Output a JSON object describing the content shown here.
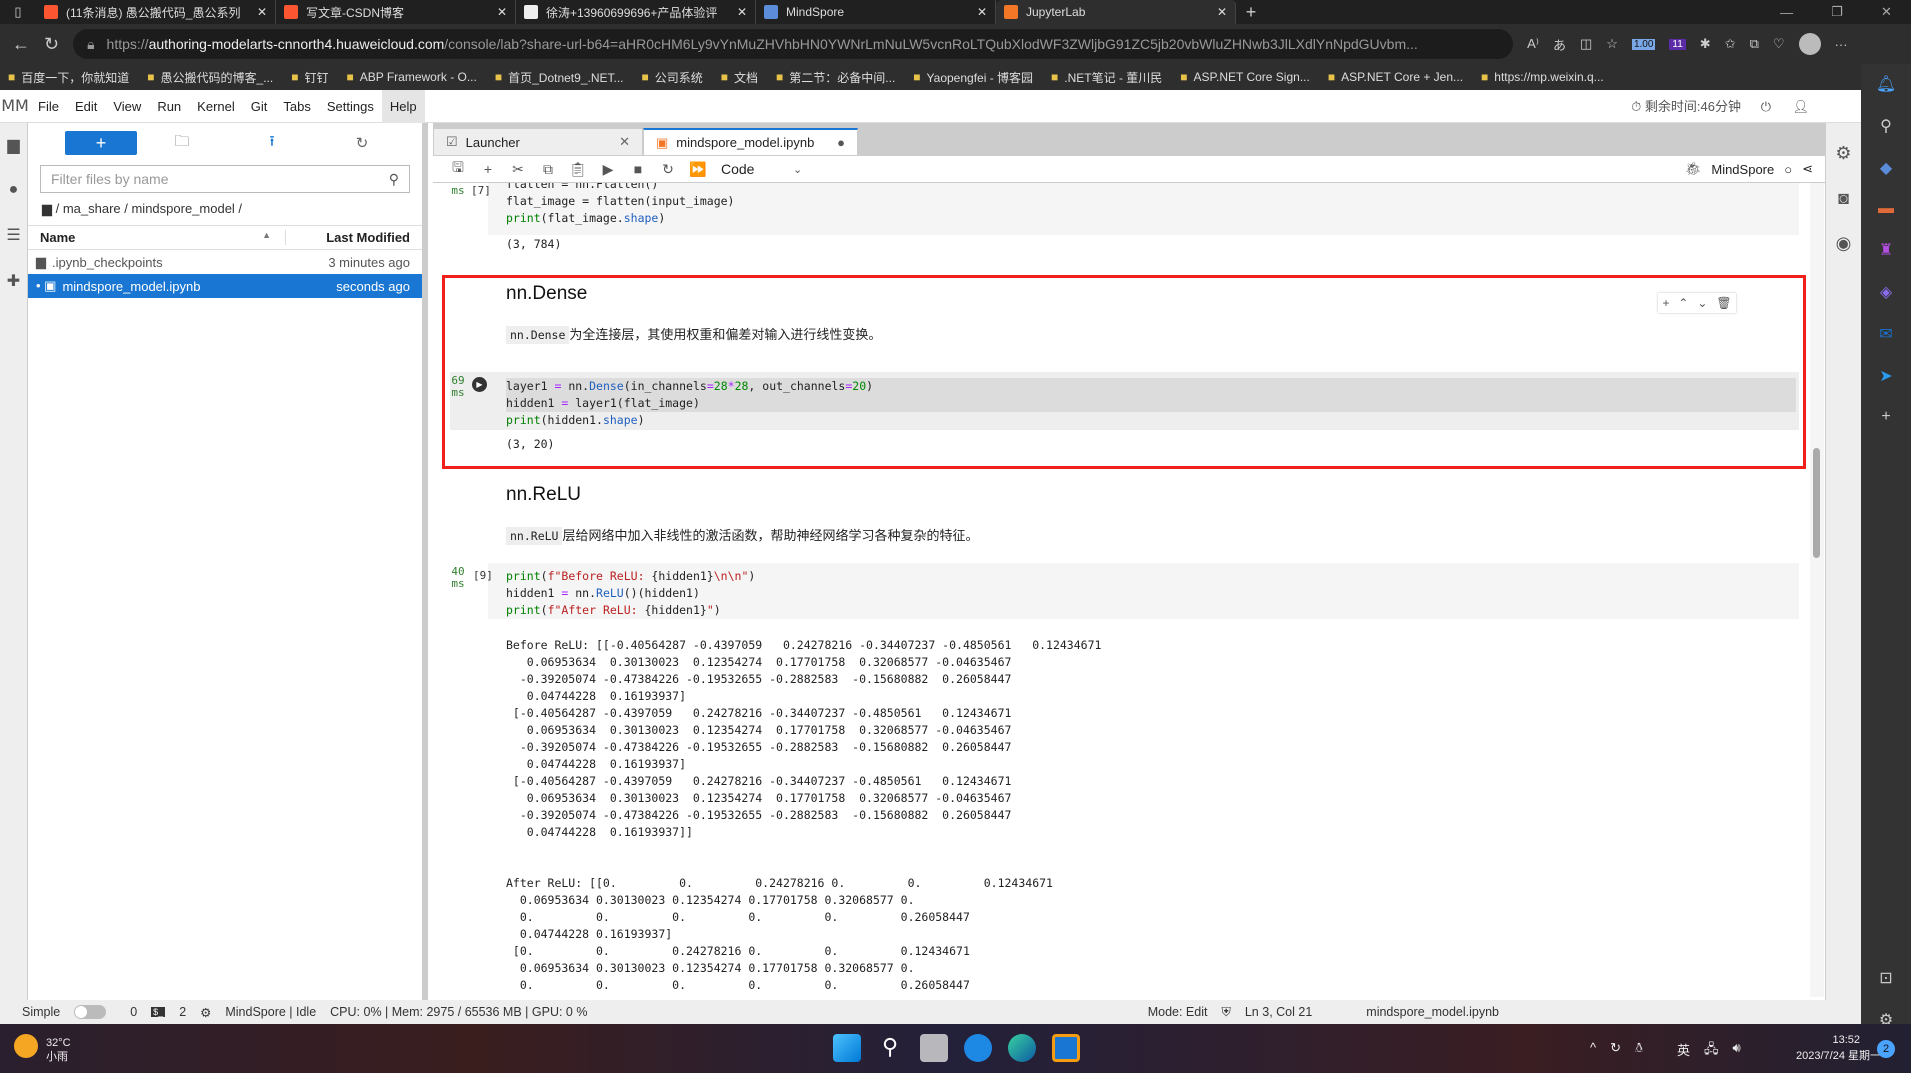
{
  "browser": {
    "tabs": [
      {
        "title": "(11条消息) 愚公搬代码_愚公系列",
        "icon_color": "#fc5531"
      },
      {
        "title": "写文章-CSDN博客",
        "icon_color": "#fc5531"
      },
      {
        "title": "徐涛+13960699696+产品体验评",
        "icon_color": "#eeeeee"
      },
      {
        "title": "MindSpore",
        "icon_color": "#5b8dd9"
      },
      {
        "title": "JupyterLab",
        "icon_color": "#f37726",
        "active": true
      }
    ],
    "url_prefix": "https://",
    "url_host": "authoring-modelarts-cnnorth4.huaweicloud.com",
    "url_path": "/console/lab?share-url-b64=aHR0cHM6Ly9vYnMuZHVhbHN0YWNrLmNuLW5vcnRoLTQubXlodWF3ZWljbG91ZC5jb20vbWluZHNwb3JlLXdlYnNpdGUvbm...",
    "ext_badges": [
      "1.00",
      "11"
    ],
    "bookmarks": [
      "百度一下，你就知道",
      "愚公搬代码的博客_...",
      "钉钉",
      "ABP Framework - O...",
      "首页_Dotnet9_.NET...",
      "公司系统",
      "文档",
      "第二节：必备中间...",
      "Yaopengfei - 博客园",
      ".NET笔记 - 董川民",
      "ASP.NET Core Sign...",
      "ASP.NET Core + Jen...",
      "https://mp.weixin.q..."
    ]
  },
  "menubar": {
    "items": [
      "File",
      "Edit",
      "View",
      "Run",
      "Kernel",
      "Git",
      "Tabs",
      "Settings",
      "Help"
    ],
    "active": "Help",
    "timer": "剩余时间:46分钟"
  },
  "filebrowser": {
    "new_label": "+",
    "filter_placeholder": "Filter files by name",
    "breadcrumb": "/ ma_share / mindspore_model /",
    "col_name": "Name",
    "col_modified": "Last Modified",
    "files": [
      {
        "name": ".ipynb_checkpoints",
        "modified": "3 minutes ago",
        "type": "folder"
      },
      {
        "name": "mindspore_model.ipynb",
        "modified": "seconds ago",
        "type": "notebook",
        "selected": true
      }
    ]
  },
  "notebook": {
    "tabs": [
      {
        "label": "Launcher"
      },
      {
        "label": "mindspore_model.ipynb",
        "active": true,
        "unsaved": true
      }
    ],
    "cell_type": "Code",
    "kernel": "MindSpore",
    "cells": {
      "prev": {
        "exec": "[7]",
        "lines": [
          [
            {
              "t": "flatten = nn.Flatten()",
              "c": ""
            }
          ],
          [
            {
              "t": "flat_image = flatten(input_image)",
              "c": ""
            }
          ],
          [
            {
              "t": "print",
              "c": "k"
            },
            {
              "t": "(flat_image.",
              "c": ""
            },
            {
              "t": "shape",
              "c": "a"
            },
            {
              "t": ")",
              "c": ""
            }
          ]
        ],
        "output": "(3, 784)"
      },
      "dense_md": {
        "heading": "nn.Dense",
        "code": "nn.Dense",
        "text": "为全连接层，其使用权重和偏差对输入进行线性变换。"
      },
      "dense_code": {
        "time": "69",
        "unit": "ms",
        "lines": [
          [
            {
              "t": "layer1 ",
              "c": ""
            },
            {
              "t": "=",
              "c": "o"
            },
            {
              "t": " nn.",
              "c": ""
            },
            {
              "t": "Dense",
              "c": "a"
            },
            {
              "t": "(in_channels",
              "c": ""
            },
            {
              "t": "=",
              "c": "o"
            },
            {
              "t": "28",
              "c": "num"
            },
            {
              "t": "*",
              "c": "o"
            },
            {
              "t": "28",
              "c": "num"
            },
            {
              "t": ", out_channels",
              "c": ""
            },
            {
              "t": "=",
              "c": "o"
            },
            {
              "t": "20",
              "c": "num"
            },
            {
              "t": ")",
              "c": ""
            }
          ],
          [
            {
              "t": "hidden1 ",
              "c": ""
            },
            {
              "t": "=",
              "c": "o"
            },
            {
              "t": " layer1(flat_image)",
              "c": ""
            }
          ],
          [
            {
              "t": "print",
              "c": "k"
            },
            {
              "t": "(hidden1.",
              "c": ""
            },
            {
              "t": "shape",
              "c": "a"
            },
            {
              "t": ")",
              "c": ""
            }
          ]
        ],
        "output": "(3, 20)"
      },
      "relu_md": {
        "heading": "nn.ReLU",
        "code": "nn.ReLU",
        "text": "层给网络中加入非线性的激活函数，帮助神经网络学习各种复杂的特征。"
      },
      "relu_code": {
        "time": "40",
        "unit": "ms",
        "exec": "[9]",
        "lines": [
          [
            {
              "t": "print",
              "c": "k"
            },
            {
              "t": "(",
              "c": ""
            },
            {
              "t": "f\"Before ReLU: ",
              "c": "s"
            },
            {
              "t": "{hidden1}",
              "c": ""
            },
            {
              "t": "\\n\\n",
              "c": "s"
            },
            {
              "t": "\"",
              "c": "s"
            },
            {
              "t": ")",
              "c": ""
            }
          ],
          [
            {
              "t": "hidden1 ",
              "c": ""
            },
            {
              "t": "=",
              "c": "o"
            },
            {
              "t": " nn.",
              "c": ""
            },
            {
              "t": "ReLU",
              "c": "a"
            },
            {
              "t": "()(hidden1)",
              "c": ""
            }
          ],
          [
            {
              "t": "print",
              "c": "k"
            },
            {
              "t": "(",
              "c": ""
            },
            {
              "t": "f\"After ReLU: ",
              "c": "s"
            },
            {
              "t": "{hidden1}",
              "c": ""
            },
            {
              "t": "\"",
              "c": "s"
            },
            {
              "t": ")",
              "c": ""
            }
          ]
        ],
        "output": [
          "Before ReLU: [[-0.40564287 -0.4397059   0.24278216 -0.34407237 -0.4850561   0.12434671",
          "   0.06953634  0.30130023  0.12354274  0.17701758  0.32068577 -0.04635467",
          "  -0.39205074 -0.47384226 -0.19532655 -0.2882583  -0.15680882  0.26058447",
          "   0.04744228  0.16193937]",
          " [-0.40564287 -0.4397059   0.24278216 -0.34407237 -0.4850561   0.12434671",
          "   0.06953634  0.30130023  0.12354274  0.17701758  0.32068577 -0.04635467",
          "  -0.39205074 -0.47384226 -0.19532655 -0.2882583  -0.15680882  0.26058447",
          "   0.04744228  0.16193937]",
          " [-0.40564287 -0.4397059   0.24278216 -0.34407237 -0.4850561   0.12434671",
          "   0.06953634  0.30130023  0.12354274  0.17701758  0.32068577 -0.04635467",
          "  -0.39205074 -0.47384226 -0.19532655 -0.2882583  -0.15680882  0.26058447",
          "   0.04744228  0.16193937]]",
          "",
          "",
          "After ReLU: [[0.         0.         0.24278216 0.         0.         0.12434671",
          "  0.06953634 0.30130023 0.12354274 0.17701758 0.32068577 0.",
          "  0.         0.         0.         0.         0.         0.26058447",
          "  0.04744228 0.16193937]",
          " [0.         0.         0.24278216 0.         0.         0.12434671",
          "  0.06953634 0.30130023 0.12354274 0.17701758 0.32068577 0.",
          "  0.         0.         0.         0.         0.         0.26058447"
        ]
      }
    }
  },
  "statusbar": {
    "mode_label": "Simple",
    "count1": "0",
    "count2": "2",
    "kernel_status": "MindSpore | Idle",
    "resources": "CPU: 0% | Mem: 2975 / 65536 MB | GPU: 0 %",
    "mode": "Mode: Edit",
    "cursor": "Ln 3, Col 21",
    "filename": "mindspore_model.ipynb"
  },
  "taskbar": {
    "temp": "32°C",
    "weather": "小雨",
    "ime": "英",
    "time": "13:52",
    "date": "2023/7/24 星期一",
    "notifications": "2"
  },
  "colors": {
    "accent": "#1976d2",
    "highlight_box": "#f0201a"
  }
}
